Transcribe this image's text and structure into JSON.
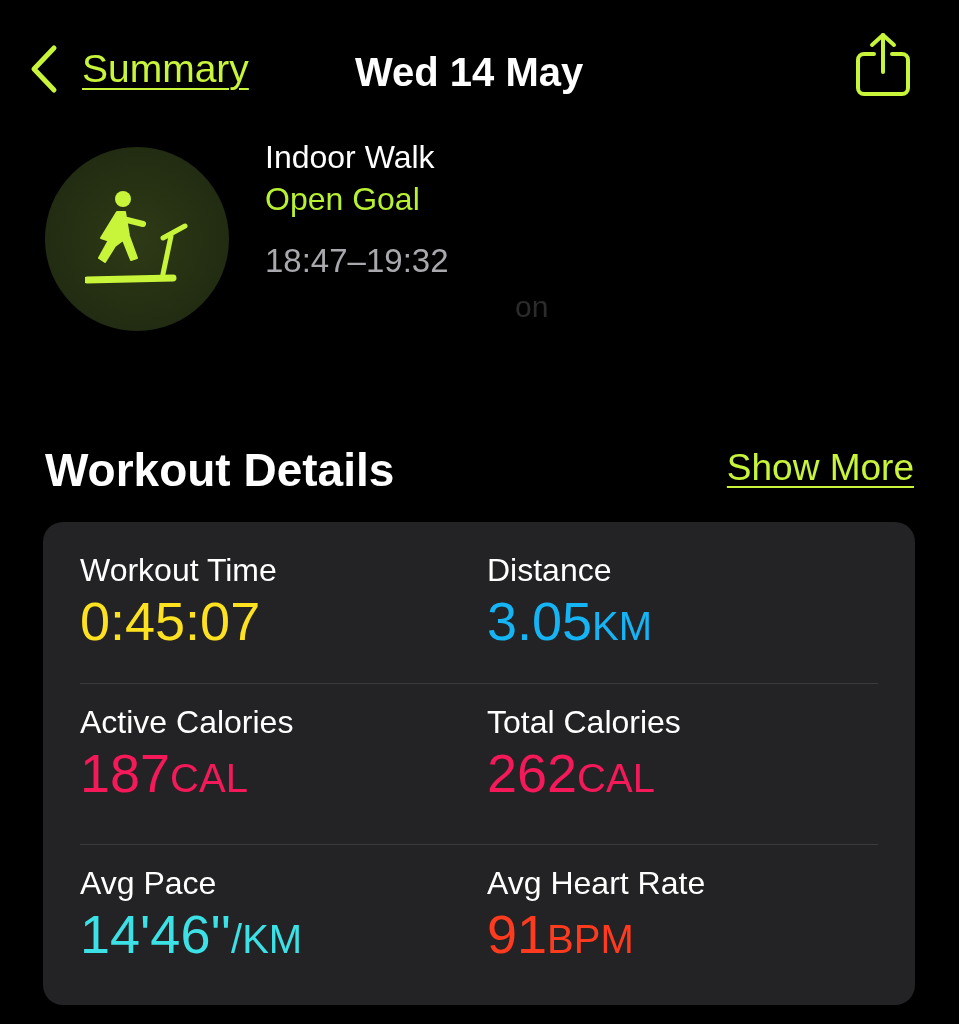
{
  "nav": {
    "back_label": "Summary",
    "title": "Wed 14 May"
  },
  "workout": {
    "name": "Indoor Walk",
    "goal": "Open Goal",
    "time_range": "18:47–19:32",
    "faint_text": "on"
  },
  "details": {
    "heading": "Workout Details",
    "show_more": "Show More",
    "metrics": [
      {
        "label": "Workout Time",
        "value": "0:45:07",
        "color": "#ffe21f"
      },
      {
        "label": "Distance",
        "value": "3.05",
        "unit": "KM",
        "color": "#14b4f5"
      },
      {
        "label": "Active Calories",
        "value": "187",
        "unit": "CAL",
        "color": "#f5195a"
      },
      {
        "label": "Total Calories",
        "value": "262",
        "unit": "CAL",
        "color": "#f5195a"
      },
      {
        "label": "Avg Pace",
        "value": "14'46''",
        "unit": "/KM",
        "color": "#3ce1e6"
      },
      {
        "label": "Avg Heart Rate",
        "value": "91",
        "unit": "BPM",
        "color": "#ff3b1f"
      }
    ]
  }
}
